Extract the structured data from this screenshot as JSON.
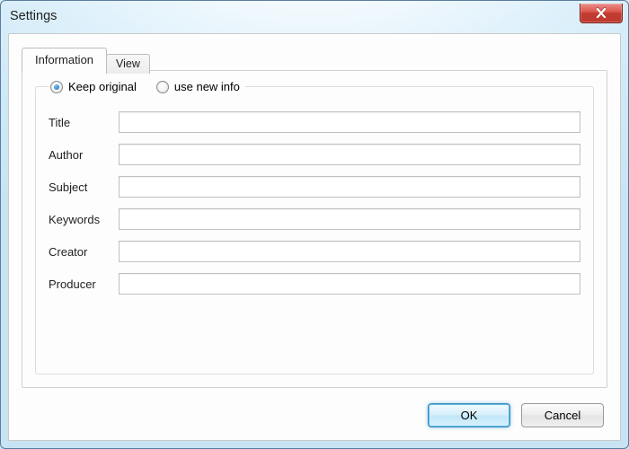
{
  "window": {
    "title": "Settings"
  },
  "tabs": {
    "information": "Information",
    "view": "View"
  },
  "group": {
    "radio_keep": "Keep original",
    "radio_new": "use new info"
  },
  "fields": {
    "title": {
      "label": "Title",
      "value": ""
    },
    "author": {
      "label": "Author",
      "value": ""
    },
    "subject": {
      "label": "Subject",
      "value": ""
    },
    "keywords": {
      "label": "Keywords",
      "value": ""
    },
    "creator": {
      "label": "Creator",
      "value": ""
    },
    "producer": {
      "label": "Producer",
      "value": ""
    }
  },
  "buttons": {
    "ok": "OK",
    "cancel": "Cancel"
  }
}
